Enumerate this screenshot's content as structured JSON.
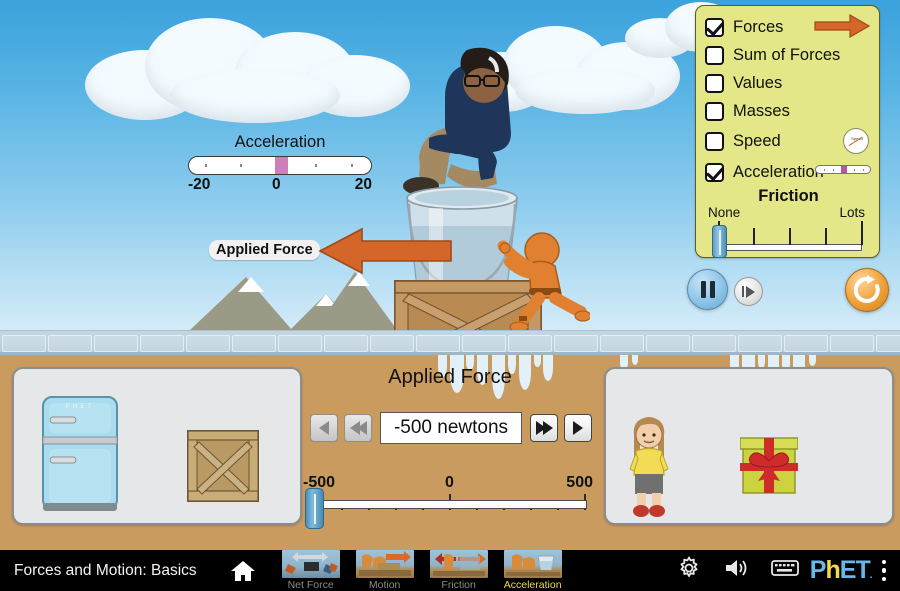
{
  "app": {
    "title": "Forces and Motion: Basics"
  },
  "scene": {
    "acceleration_meter": {
      "title": "Acceleration",
      "min_label": "-20",
      "mid_label": "0",
      "max_label": "20",
      "value": 0
    },
    "applied_force_arrow_label": "Applied Force",
    "arrow_color": "#d4662a"
  },
  "control_panel": {
    "checkboxes": [
      {
        "label": "Forces",
        "checked": true,
        "icon": "orange-arrow-icon"
      },
      {
        "label": "Sum of Forces",
        "checked": false
      },
      {
        "label": "Values",
        "checked": false
      },
      {
        "label": "Masses",
        "checked": false
      },
      {
        "label": "Speed",
        "checked": false,
        "icon": "speedometer-icon",
        "icon_text": "Speed"
      },
      {
        "label": "Acceleration",
        "checked": true,
        "icon": "acceleration-meter-icon"
      }
    ],
    "friction": {
      "title": "Friction",
      "min_label": "None",
      "max_label": "Lots",
      "value": 0
    },
    "panel_color": "#e3e788"
  },
  "playback": {
    "pause_label": "Pause",
    "step_label": "Step Forward",
    "reset_label": "Reset All",
    "paused": true
  },
  "toolboxes": {
    "left": {
      "items": [
        "refrigerator",
        "wooden-crate"
      ],
      "fridge_text": "PHET"
    },
    "right": {
      "items": [
        "girl",
        "gift-box"
      ]
    }
  },
  "applied_force": {
    "title": "Applied Force",
    "value_text": "-500 newtons",
    "value": -500,
    "min_label": "-500",
    "mid_label": "0",
    "max_label": "500",
    "buttons": {
      "left_small": "◀",
      "left_large": "◀◀",
      "right_large": "▶▶",
      "right_small": "▶"
    },
    "left_buttons_disabled": true
  },
  "navbar": {
    "home_label": "Home",
    "tabs": [
      {
        "label": "Net Force",
        "active": false
      },
      {
        "label": "Motion",
        "active": false
      },
      {
        "label": "Friction",
        "active": false
      },
      {
        "label": "Acceleration",
        "active": true
      }
    ],
    "icons": [
      "gear-icon",
      "sound-icon",
      "keyboard-icon"
    ],
    "logo": "PhET",
    "menu": "kebab-menu-icon",
    "active_tab_color": "#f2d94a"
  }
}
